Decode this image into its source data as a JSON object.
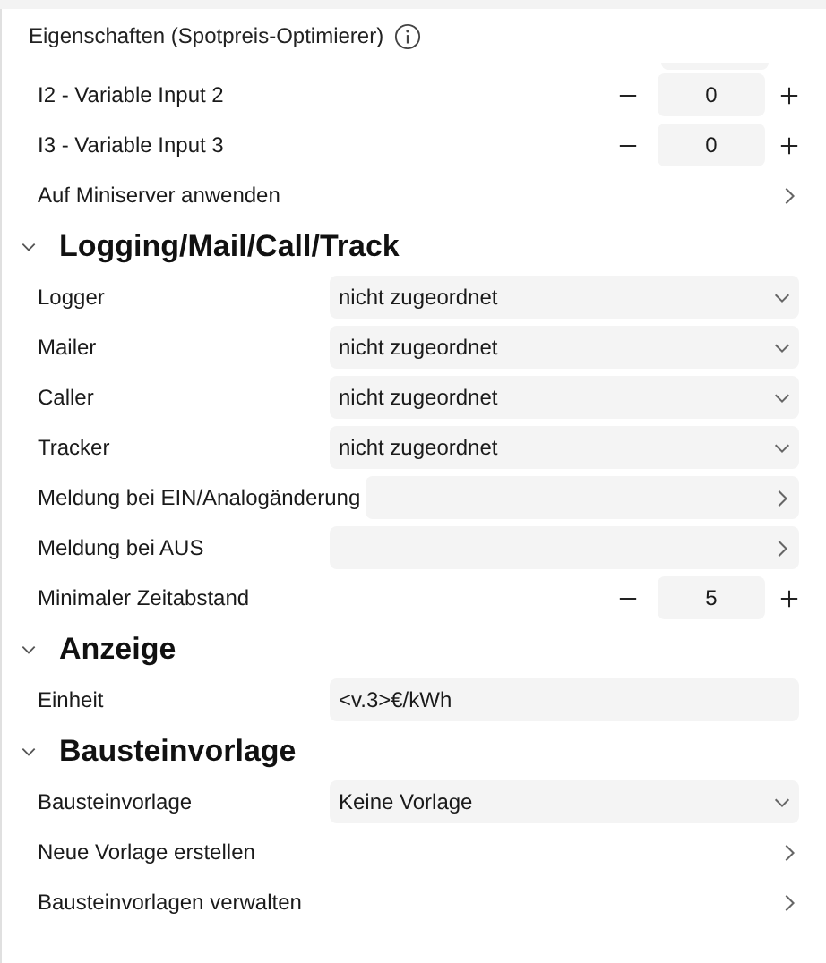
{
  "panel": {
    "title": "Eigenschaften (Spotpreis-Optimierer)"
  },
  "rows": [
    {
      "kind": "stepper",
      "label": "I2 - Variable Input 2",
      "value": "0"
    },
    {
      "kind": "stepper",
      "label": "I3 - Variable Input 3",
      "value": "0"
    },
    {
      "kind": "link",
      "label": "Auf Miniserver anwenden"
    }
  ],
  "sections": [
    {
      "title": "Logging/Mail/Call/Track",
      "expanded": true,
      "rows": [
        {
          "kind": "dropdown",
          "label": "Logger",
          "value": "nicht zugeordnet"
        },
        {
          "kind": "dropdown",
          "label": "Mailer",
          "value": "nicht zugeordnet"
        },
        {
          "kind": "dropdown",
          "label": "Caller",
          "value": "nicht zugeordnet"
        },
        {
          "kind": "dropdown",
          "label": "Tracker",
          "value": "nicht zugeordnet"
        },
        {
          "kind": "link-field",
          "label": "Meldung bei EIN/Analogänderung"
        },
        {
          "kind": "link-field",
          "label": "Meldung bei AUS"
        },
        {
          "kind": "stepper",
          "label": "Minimaler Zeitabstand",
          "value": "5"
        }
      ]
    },
    {
      "title": "Anzeige",
      "expanded": true,
      "rows": [
        {
          "kind": "text",
          "label": "Einheit",
          "value": "<v.3>€/kWh"
        }
      ]
    },
    {
      "title": "Bausteinvorlage",
      "expanded": true,
      "rows": [
        {
          "kind": "dropdown",
          "label": "Bausteinvorlage",
          "value": "Keine Vorlage"
        },
        {
          "kind": "link",
          "label": "Neue Vorlage erstellen"
        },
        {
          "kind": "link",
          "label": "Bausteinvorlagen verwalten"
        }
      ]
    }
  ]
}
